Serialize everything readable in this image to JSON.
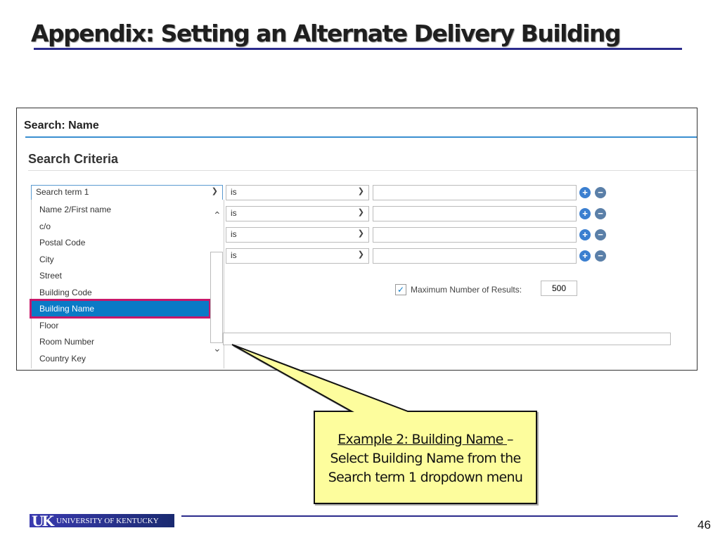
{
  "slide": {
    "title": "Appendix: Setting an Alternate Delivery Building",
    "page_number": "46",
    "logo_text": "UNIVERSITY OF KENTUCKY",
    "logo_mark": "UK"
  },
  "screen": {
    "header": "Search: Name",
    "section": "Search Criteria",
    "rows": [
      {
        "field": "Search term 1",
        "operator": "is",
        "value": ""
      },
      {
        "operator": "is",
        "value": ""
      },
      {
        "operator": "is",
        "value": ""
      },
      {
        "operator": "is",
        "value": ""
      }
    ],
    "dropdown_options": [
      "Name 2/First name",
      "c/o",
      "Postal Code",
      "City",
      "Street",
      "Building Code",
      "Building Name",
      "Floor",
      "Room Number",
      "Country Key"
    ],
    "selected_option": "Building Name",
    "max_results": {
      "label": "Maximum Number of Results:",
      "value": "500",
      "checked": true
    },
    "colors": {
      "accent": "#0a7ac6",
      "highlight_border": "#c8186a",
      "add_icon": "#3b7fd0",
      "remove_icon": "#5a7fa8"
    }
  },
  "callout": {
    "link": "Example 2: Building Name ",
    "dash": "–",
    "line2": "Select Building Name from the",
    "line3": "Search term 1 dropdown menu"
  }
}
